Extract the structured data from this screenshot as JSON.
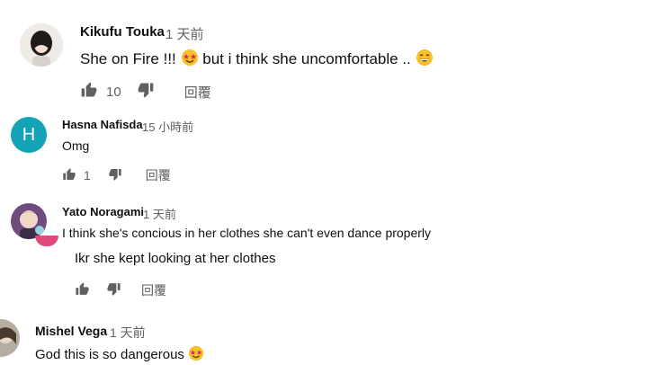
{
  "comments": [
    {
      "author": "Kikufu Touka",
      "time": "1 天前",
      "text": "She on Fire !!!",
      "text2": "but i think she uncomfortable ..",
      "likes": "10",
      "reply_label": "回覆",
      "avatar_icon": "user-photo-avatar"
    },
    {
      "author": "Hasna Nafisda",
      "time": "15 小時前",
      "text": "Omg",
      "likes": "1",
      "reply_label": "回覆",
      "avatar_letter": "H",
      "avatar_color": "#12a4b6"
    },
    {
      "author": "Yato Noragami",
      "time": "1 天前",
      "text": "I think she's concious in her clothes she can't even dance properly",
      "avatar_icon": "user-photo-avatar"
    },
    {
      "text": "Ikr she kept looking at her clothes",
      "reply_label": "回覆"
    },
    {
      "author": "Mishel Vega",
      "time": "1 天前",
      "text": "God this is so dangerous",
      "avatar_icon": "user-photo-avatar"
    }
  ],
  "colors": {
    "secondary_text": "#606060",
    "emoji_yellow": "#f7c02b",
    "emoji_red": "#e0245e",
    "reply_avatar_pink": "#e04a7a"
  },
  "icons": [
    "thumb-up-icon",
    "thumb-down-icon",
    "star-eyes-emoji",
    "grin-emoji"
  ]
}
